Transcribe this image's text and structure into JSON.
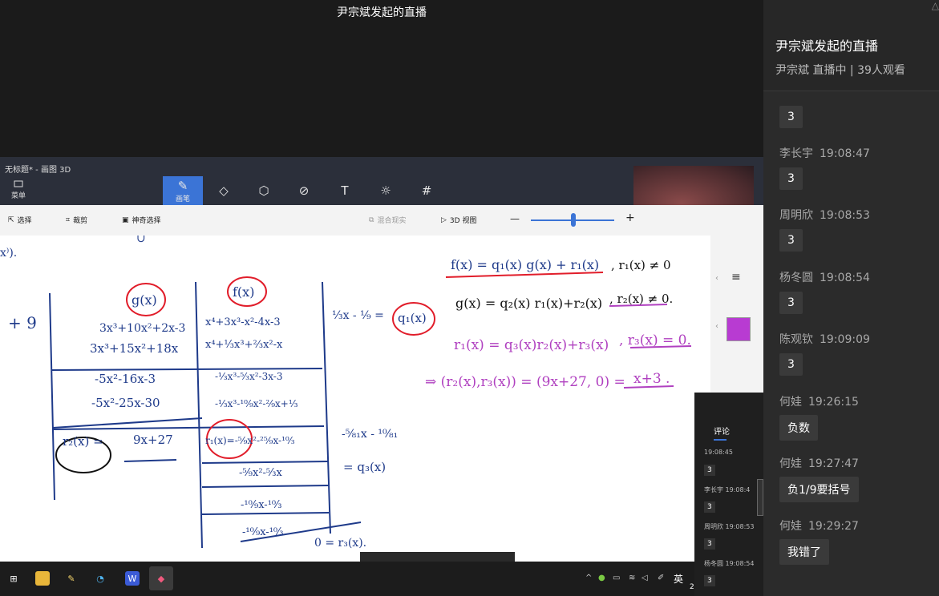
{
  "stream": {
    "title": "尹宗斌发起的直播"
  },
  "paint3d": {
    "window_title": "无标题* - 画图 3D",
    "menu_label": "菜单",
    "active_tool_label": "画笔",
    "toolbar_icons": [
      "brush-icon",
      "2d-shapes-icon",
      "3d-shapes-icon",
      "stickers-icon",
      "text-icon",
      "effects-icon",
      "canvas-icon"
    ],
    "sub": {
      "select": "选择",
      "crop": "裁剪",
      "magic_select": "神奇选择",
      "mixed_reality": "混合现实",
      "view_3d": "3D 视图"
    },
    "zoom_minus": "—",
    "zoom_plus": "+",
    "zoom_level_fraction": 0.52,
    "brush_color": "#b83bd2"
  },
  "handwriting": {
    "x_frag": "x⁾).",
    "u": "∪",
    "plus9": "+ 9",
    "gx": "g(x)",
    "fx": "f(x)",
    "left_rows": [
      "3x³+10x²+2x-3",
      "3x³+15x²+18x",
      "-5x²-16x-3",
      "-5x²-25x-30",
      "9x+27"
    ],
    "r2": "r₂(x) =",
    "right_rows": [
      "x⁴+3x³-x²-4x-3",
      "x⁴+⅓x³+⅔x²-x",
      "-⅓x³-⁵⁄₃x²-3x-3",
      "-⅓x³-¹⁰⁄₉x²-²⁄₉x+⅓",
      "r₁(x)=-⁵⁄₉x²-²⁵⁄₉x-¹⁰⁄₃",
      "-⁵⁄₉x²-⁵⁄₃x",
      "-¹⁰⁄₉x-¹⁰⁄₃",
      "-¹⁰⁄₉x-¹⁰⁄₃",
      "0 = r₃(x)."
    ],
    "q1": "⅓x - ¹⁄₉ =",
    "q1_label": "q₁(x)",
    "q3": "-⁵⁄₈₁x - ¹⁰⁄₈₁",
    "q3_label": "= q₃(x)",
    "eq1": "f(x) = q₁(x) g(x) + r₁(x)",
    "eq1b": ", r₁(x) ≠ 0",
    "eq2": "g(x) = q₂(x) r₁(x)+r₂(x)",
    "eq2b": ", r₂(x) ≠ 0.",
    "eq3": "r₁(x) = q₃(x)r₂(x)+r₃(x)",
    "eq3b": ", r₃(x) = 0.",
    "eq4": "⇒ (r₂(x),r₃(x)) = (9x+27, 0) =",
    "eq4b": "x+3 ."
  },
  "mini_comments": {
    "tab": "评论",
    "entries": [
      {
        "name": "19:08:45",
        "msg": "3"
      },
      {
        "name": "李长宇 19:08:4",
        "msg": "3"
      },
      {
        "name": "周明欣 19:08:53",
        "msg": "3"
      },
      {
        "name": "杨冬圆 19:08:54",
        "msg": "3"
      }
    ]
  },
  "taskbar": {
    "apps": [
      "file-explorer-icon",
      "notepad-icon",
      "search-app-icon",
      "wps-icon",
      "paint3d-icon"
    ],
    "tray_ime": "英",
    "tray_clock": "2"
  },
  "sidebar": {
    "title": "尹宗斌发起的直播",
    "host": "尹宗斌",
    "status": "直播中",
    "viewers": "39人观看",
    "first_msg": "3",
    "comments": [
      {
        "name": "李长宇",
        "time": "19:08:47",
        "msg": "3"
      },
      {
        "name": "周明欣",
        "time": "19:08:53",
        "msg": "3"
      },
      {
        "name": "杨冬圆",
        "time": "19:08:54",
        "msg": "3"
      },
      {
        "name": "陈观钦",
        "time": "19:09:09",
        "msg": "3"
      },
      {
        "name": "何娃",
        "time": "19:26:15",
        "msg": "负数"
      },
      {
        "name": "何娃",
        "time": "19:27:47",
        "msg": "负1/9要括号"
      },
      {
        "name": "何娃",
        "time": "19:29:27",
        "msg": "我错了"
      }
    ]
  }
}
